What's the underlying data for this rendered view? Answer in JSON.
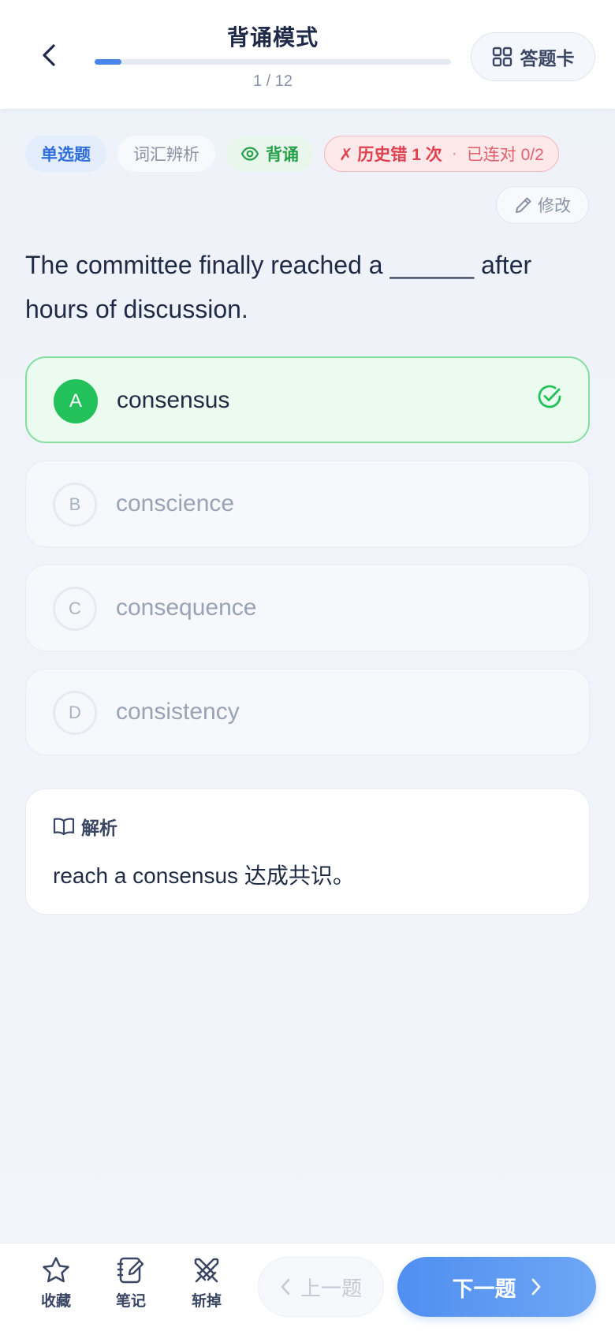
{
  "header": {
    "title": "背诵模式",
    "progress_text": "1 / 12",
    "progress_fraction": 0.075,
    "answer_card_label": "答题卡"
  },
  "tags": {
    "question_type": "单选题",
    "category": "词汇辨析",
    "mode": "背诵",
    "history_error": "✗ 历史错 1 次",
    "separator": "·",
    "streak": "已连对 0/2"
  },
  "edit_label": "修改",
  "question": "The committee finally reached a ______ after hours of discussion.",
  "options": [
    {
      "letter": "A",
      "text": "consensus",
      "state": "correct"
    },
    {
      "letter": "B",
      "text": "conscience",
      "state": "normal"
    },
    {
      "letter": "C",
      "text": "consequence",
      "state": "normal"
    },
    {
      "letter": "D",
      "text": "consistency",
      "state": "normal"
    }
  ],
  "analysis": {
    "title": "解析",
    "body": "reach a consensus 达成共识。"
  },
  "bottom": {
    "favorite": "收藏",
    "notes": "笔记",
    "remove": "斩掉",
    "prev": "上一题",
    "next": "下一题"
  },
  "colors": {
    "accent": "#4a86ea",
    "correct": "#22c15a",
    "error": "#e0414f"
  }
}
